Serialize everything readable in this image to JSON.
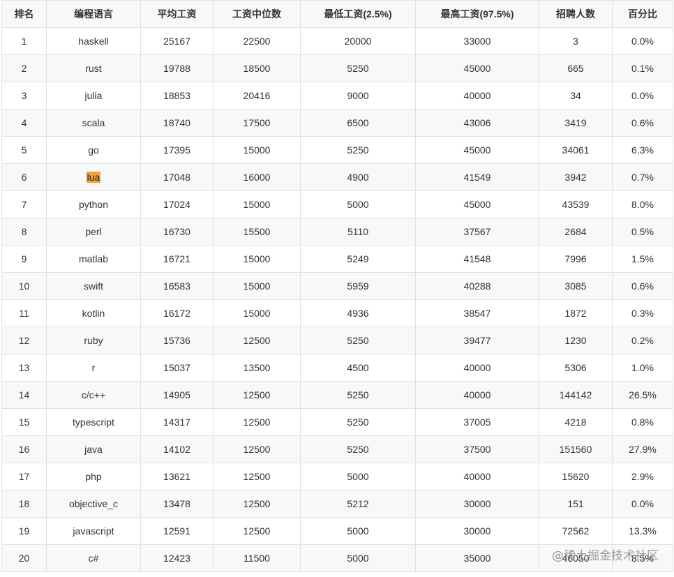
{
  "table": {
    "headers": [
      "排名",
      "编程语言",
      "平均工资",
      "工资中位数",
      "最低工资(2.5%)",
      "最高工资(97.5%)",
      "招聘人数",
      "百分比"
    ],
    "rows": [
      [
        "1",
        "haskell",
        "25167",
        "22500",
        "20000",
        "33000",
        "3",
        "0.0%"
      ],
      [
        "2",
        "rust",
        "19788",
        "18500",
        "5250",
        "45000",
        "665",
        "0.1%"
      ],
      [
        "3",
        "julia",
        "18853",
        "20416",
        "9000",
        "40000",
        "34",
        "0.0%"
      ],
      [
        "4",
        "scala",
        "18740",
        "17500",
        "6500",
        "43006",
        "3419",
        "0.6%"
      ],
      [
        "5",
        "go",
        "17395",
        "15000",
        "5250",
        "45000",
        "34061",
        "6.3%"
      ],
      [
        "6",
        "lua",
        "17048",
        "16000",
        "4900",
        "41549",
        "3942",
        "0.7%"
      ],
      [
        "7",
        "python",
        "17024",
        "15000",
        "5000",
        "45000",
        "43539",
        "8.0%"
      ],
      [
        "8",
        "perl",
        "16730",
        "15500",
        "5110",
        "37567",
        "2684",
        "0.5%"
      ],
      [
        "9",
        "matlab",
        "16721",
        "15000",
        "5249",
        "41548",
        "7996",
        "1.5%"
      ],
      [
        "10",
        "swift",
        "16583",
        "15000",
        "5959",
        "40288",
        "3085",
        "0.6%"
      ],
      [
        "11",
        "kotlin",
        "16172",
        "15000",
        "4936",
        "38547",
        "1872",
        "0.3%"
      ],
      [
        "12",
        "ruby",
        "15736",
        "12500",
        "5250",
        "39477",
        "1230",
        "0.2%"
      ],
      [
        "13",
        "r",
        "15037",
        "13500",
        "4500",
        "40000",
        "5306",
        "1.0%"
      ],
      [
        "14",
        "c/c++",
        "14905",
        "12500",
        "5250",
        "40000",
        "144142",
        "26.5%"
      ],
      [
        "15",
        "typescript",
        "14317",
        "12500",
        "5250",
        "37005",
        "4218",
        "0.8%"
      ],
      [
        "16",
        "java",
        "14102",
        "12500",
        "5250",
        "37500",
        "151560",
        "27.9%"
      ],
      [
        "17",
        "php",
        "13621",
        "12500",
        "5000",
        "40000",
        "15620",
        "2.9%"
      ],
      [
        "18",
        "objective_c",
        "13478",
        "12500",
        "5212",
        "30000",
        "151",
        "0.0%"
      ],
      [
        "19",
        "javascript",
        "12591",
        "12500",
        "5000",
        "30000",
        "72562",
        "13.3%"
      ],
      [
        "20",
        "c#",
        "12423",
        "11500",
        "5000",
        "35000",
        "46050",
        "8.5%"
      ]
    ],
    "highlighted_cell": {
      "row": 5,
      "col": 1
    }
  },
  "colors": {
    "header_bg": "#f6f8fa",
    "stripe_bg": "#f6f8fa",
    "border": "#dfe2e5",
    "highlight": "#f0a23b"
  },
  "watermark": "@稀土掘金技术社区"
}
